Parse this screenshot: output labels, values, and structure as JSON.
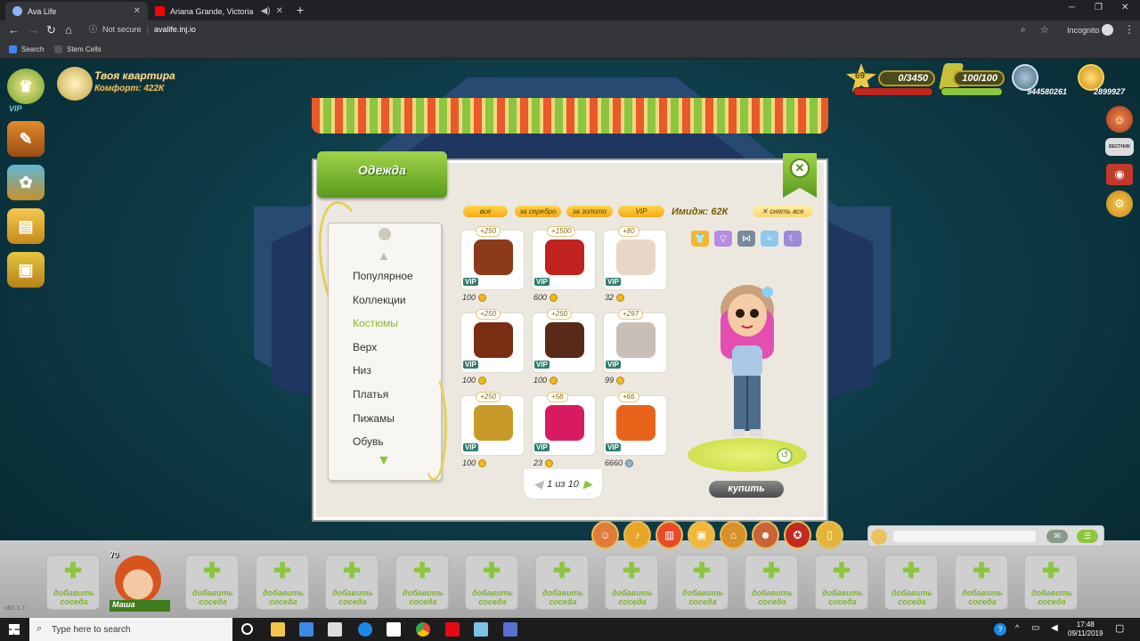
{
  "browser": {
    "tabs": [
      {
        "title": "Ava Life",
        "close": "✕",
        "color": "#8ab4f8"
      },
      {
        "title": "Ariana Grande, Victoria Mon",
        "audio": "◀)",
        "close": "✕",
        "color": "#ff0000"
      }
    ],
    "new_tab": "+",
    "window_controls": {
      "minimize": "─",
      "maximize": "❐",
      "close": "✕"
    },
    "nav": {
      "back": "←",
      "forward": "→",
      "reload": "↻",
      "home": "⌂"
    },
    "security": "Not secure",
    "url": "avalife.inj.io",
    "incognito": "Incognito",
    "bookmarks": [
      {
        "label": "Search",
        "color": "#4285f4"
      },
      {
        "label": "Stem Cells",
        "color": "#555555"
      }
    ]
  },
  "hud": {
    "apartment": "Твоя квартира",
    "comfort": "Комфорт: 422К",
    "vip_badge": "VIP",
    "level": "69",
    "xp": "0/3450",
    "energy": "100/100",
    "silver": "944580261",
    "gold": "2899927",
    "news_label": "ВЕСТНИК"
  },
  "dialog": {
    "title": "Одежда",
    "close": "✕",
    "categories": [
      "Популярное",
      "Коллекции",
      "Костюмы",
      "Верх",
      "Низ",
      "Платья",
      "Пижамы",
      "Обувь"
    ],
    "selected_category": "Костюмы",
    "filters": [
      "все",
      "за серебро",
      "за золото",
      "VIP"
    ],
    "image_label": "Имидж: 62К",
    "remove_all": "снять все",
    "items": [
      {
        "bonus": "+250",
        "price": "100",
        "currency": "gold",
        "vip": "VIP",
        "color": "#8b3a1a"
      },
      {
        "bonus": "+1500",
        "price": "600",
        "currency": "gold",
        "vip": "VIP",
        "color": "#c0221f"
      },
      {
        "bonus": "+80",
        "price": "32",
        "currency": "gold",
        "vip": "VIP",
        "color": "#e8d7c7"
      },
      {
        "bonus": "+250",
        "price": "100",
        "currency": "gold",
        "vip": "VIP",
        "color": "#7a2e12"
      },
      {
        "bonus": "+250",
        "price": "100",
        "currency": "gold",
        "vip": "VIP",
        "color": "#5a2a18"
      },
      {
        "bonus": "+297",
        "price": "99",
        "currency": "gold",
        "vip": "VIP",
        "color": "#c9bfb6"
      },
      {
        "bonus": "+250",
        "price": "100",
        "currency": "gold",
        "vip": "VIP",
        "color": "#c89a2a"
      },
      {
        "bonus": "+58",
        "price": "23",
        "currency": "gold",
        "vip": "VIP",
        "color": "#d81b60"
      },
      {
        "bonus": "+66",
        "price": "6660",
        "currency": "silver",
        "vip": "VIP",
        "color": "#e8641b"
      }
    ],
    "pagination": "1 из 10",
    "buy": "купить"
  },
  "friends": {
    "self_name": "Маша",
    "self_level": "70",
    "add_label": "добавить соседа"
  },
  "version": "v82.1.7",
  "taskbar": {
    "search": "Type here to search",
    "time": "17:48",
    "date": "09/11/2019"
  }
}
